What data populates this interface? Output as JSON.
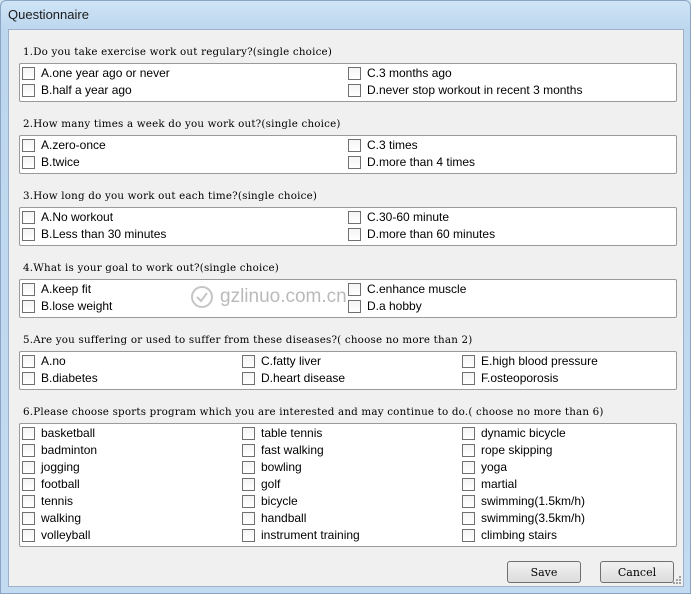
{
  "window": {
    "title": "Questionnaire"
  },
  "questions": [
    {
      "title": "1.Do you  take exercise work out regulary?(single choice)",
      "options": [
        "A.one year ago or never",
        "B.half a year ago",
        "C.3 months ago",
        "D.never stop workout in recent 3 months"
      ]
    },
    {
      "title": "2.How many times a week do you work out?(single choice)",
      "options": [
        "A.zero-once",
        "B.twice",
        "C.3 times",
        "D.more than 4 times"
      ]
    },
    {
      "title": "3.How long do you work out each time?(single choice)",
      "options": [
        "A.No workout",
        "B.Less than 30 minutes",
        "C.30-60 minute",
        "D.more than 60 minutes"
      ]
    },
    {
      "title": "4.What is your goal to work out?(single choice)",
      "options": [
        "A.keep fit",
        "B.lose weight",
        "C.enhance muscle",
        "D.a hobby"
      ]
    },
    {
      "title": "5.Are you suffering or used to suffer from these diseases?( choose no more than 2)",
      "options": [
        "A.no",
        "B.diabetes",
        "C.fatty liver",
        "D.heart disease",
        "E.high blood pressure",
        "F.osteoporosis"
      ]
    },
    {
      "title": "6.Please choose sports program which you are interested and may continue to do.( choose no more than 6)",
      "options": [
        "basketball",
        "badminton",
        "jogging",
        "football",
        "tennis",
        "walking",
        "volleyball",
        "table tennis",
        "fast walking",
        "bowling",
        "golf",
        "bicycle",
        "handball",
        "instrument training",
        "dynamic bicycle",
        "rope skipping",
        "yoga",
        "martial",
        "swimming(1.5km/h)",
        "swimming(3.5km/h)",
        "climbing stairs"
      ]
    }
  ],
  "buttons": {
    "save": "Save",
    "cancel": "Cancel"
  },
  "watermark": "gzlinuo.com.cn"
}
